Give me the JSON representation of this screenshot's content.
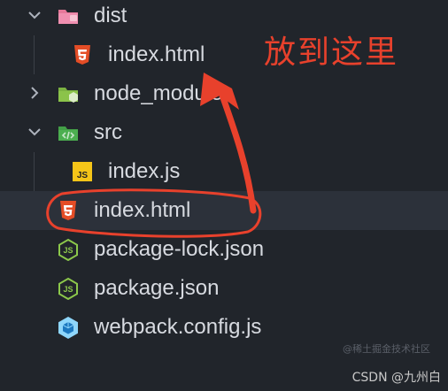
{
  "explorer": {
    "items": [
      {
        "label": "dist",
        "icon": "folder-dist-icon",
        "expanded": true
      },
      {
        "label": "index.html",
        "icon": "html5-icon"
      },
      {
        "label": "node_modules",
        "icon": "folder-node-icon",
        "expanded": false
      },
      {
        "label": "src",
        "icon": "folder-src-icon",
        "expanded": true
      },
      {
        "label": "index.js",
        "icon": "js-icon"
      },
      {
        "label": "index.html",
        "icon": "html5-icon",
        "selected": true
      },
      {
        "label": "package-lock.json",
        "icon": "nodejs-icon"
      },
      {
        "label": "package.json",
        "icon": "nodejs-icon"
      },
      {
        "label": "webpack.config.js",
        "icon": "webpack-icon"
      }
    ]
  },
  "annotation": {
    "text": "放到这里",
    "color": "#e8412c"
  },
  "watermark": {
    "text": "CSDN @九州白",
    "faint_text": "@稀土掘金技术社区"
  },
  "colors": {
    "background": "#21252b",
    "selected_row": "#2c313a",
    "text": "#d7dae0",
    "html_icon": "#e44d26",
    "js_icon": "#f5c518",
    "node_icon": "#8cc84b",
    "webpack_icon": "#8ed6fb"
  }
}
